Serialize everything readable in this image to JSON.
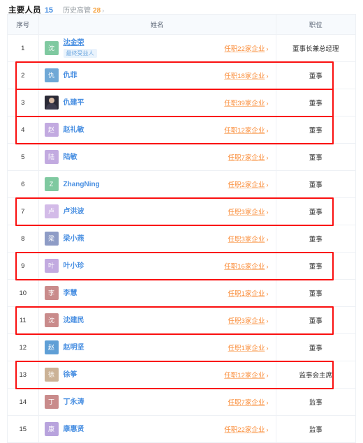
{
  "header": {
    "title": "主要人员",
    "count": "15",
    "sub_label": "历史高管",
    "sub_count": "28",
    "sub_arrow": "›"
  },
  "table": {
    "columns": {
      "index": "序号",
      "name": "姓名",
      "position": "职位"
    },
    "job_link_chevron": "›",
    "rows": [
      {
        "index": "1",
        "avatar_text": "沈",
        "avatar_color": "#7fc9a0",
        "avatar_type": "initial",
        "name": "沈金荣",
        "badge": "最终受益人",
        "job_link": "任职22家企业",
        "position": "董事长兼总经理",
        "highlighted": false
      },
      {
        "index": "2",
        "avatar_text": "仇",
        "avatar_color": "#6fa8d6",
        "avatar_type": "initial",
        "name": "仇菲",
        "badge": "",
        "job_link": "任职18家企业",
        "position": "董事",
        "highlighted": true
      },
      {
        "index": "3",
        "avatar_text": "仇",
        "avatar_color": "#2b2a36",
        "avatar_type": "photo",
        "name": "仇建平",
        "badge": "",
        "job_link": "任职39家企业",
        "position": "董事",
        "highlighted": true
      },
      {
        "index": "4",
        "avatar_text": "赵",
        "avatar_color": "#c2aae0",
        "avatar_type": "initial",
        "name": "赵礼敏",
        "badge": "",
        "job_link": "任职12家企业",
        "position": "董事",
        "highlighted": true
      },
      {
        "index": "5",
        "avatar_text": "陆",
        "avatar_color": "#c2aae0",
        "avatar_type": "initial",
        "name": "陆敏",
        "badge": "",
        "job_link": "任职7家企业",
        "position": "董事",
        "highlighted": false
      },
      {
        "index": "6",
        "avatar_text": "Z",
        "avatar_color": "#7fc9a0",
        "avatar_type": "initial",
        "name": "ZhangNing",
        "badge": "",
        "job_link": "任职2家企业",
        "position": "董事",
        "highlighted": false
      },
      {
        "index": "7",
        "avatar_text": "卢",
        "avatar_color": "#d3bbe8",
        "avatar_type": "initial",
        "name": "卢洪波",
        "badge": "",
        "job_link": "任职3家企业",
        "position": "董事",
        "highlighted": true
      },
      {
        "index": "8",
        "avatar_text": "梁",
        "avatar_color": "#8e9cc6",
        "avatar_type": "initial",
        "name": "梁小燕",
        "badge": "",
        "job_link": "任职3家企业",
        "position": "董事",
        "highlighted": false
      },
      {
        "index": "9",
        "avatar_text": "叶",
        "avatar_color": "#c2aae0",
        "avatar_type": "initial",
        "name": "叶小珍",
        "badge": "",
        "job_link": "任职16家企业",
        "position": "董事",
        "highlighted": true
      },
      {
        "index": "10",
        "avatar_text": "李",
        "avatar_color": "#c98b8b",
        "avatar_type": "initial",
        "name": "李慧",
        "badge": "",
        "job_link": "任职1家企业",
        "position": "董事",
        "highlighted": false
      },
      {
        "index": "11",
        "avatar_text": "沈",
        "avatar_color": "#c98b8b",
        "avatar_type": "initial",
        "name": "沈建民",
        "badge": "",
        "job_link": "任职3家企业",
        "position": "董事",
        "highlighted": true
      },
      {
        "index": "12",
        "avatar_text": "赵",
        "avatar_color": "#5f9fd6",
        "avatar_type": "initial",
        "name": "赵明坚",
        "badge": "",
        "job_link": "任职1家企业",
        "position": "董事",
        "highlighted": false
      },
      {
        "index": "13",
        "avatar_text": "徐",
        "avatar_color": "#cbb296",
        "avatar_type": "initial",
        "name": "徐筝",
        "badge": "",
        "job_link": "任职12家企业",
        "position": "监事会主席",
        "highlighted": true
      },
      {
        "index": "14",
        "avatar_text": "丁",
        "avatar_color": "#c98b8b",
        "avatar_type": "initial",
        "name": "丁永涛",
        "badge": "",
        "job_link": "任职7家企业",
        "position": "监事",
        "highlighted": false
      },
      {
        "index": "15",
        "avatar_text": "康",
        "avatar_color": "#b8a3dd",
        "avatar_type": "initial",
        "name": "康惠贤",
        "badge": "",
        "job_link": "任职22家企业",
        "position": "监事",
        "highlighted": false
      }
    ]
  },
  "annotations": {
    "box_color": "#fa0f0f",
    "highlighted_row_indexes": [
      "2",
      "3",
      "4",
      "7",
      "9",
      "11",
      "13"
    ]
  }
}
